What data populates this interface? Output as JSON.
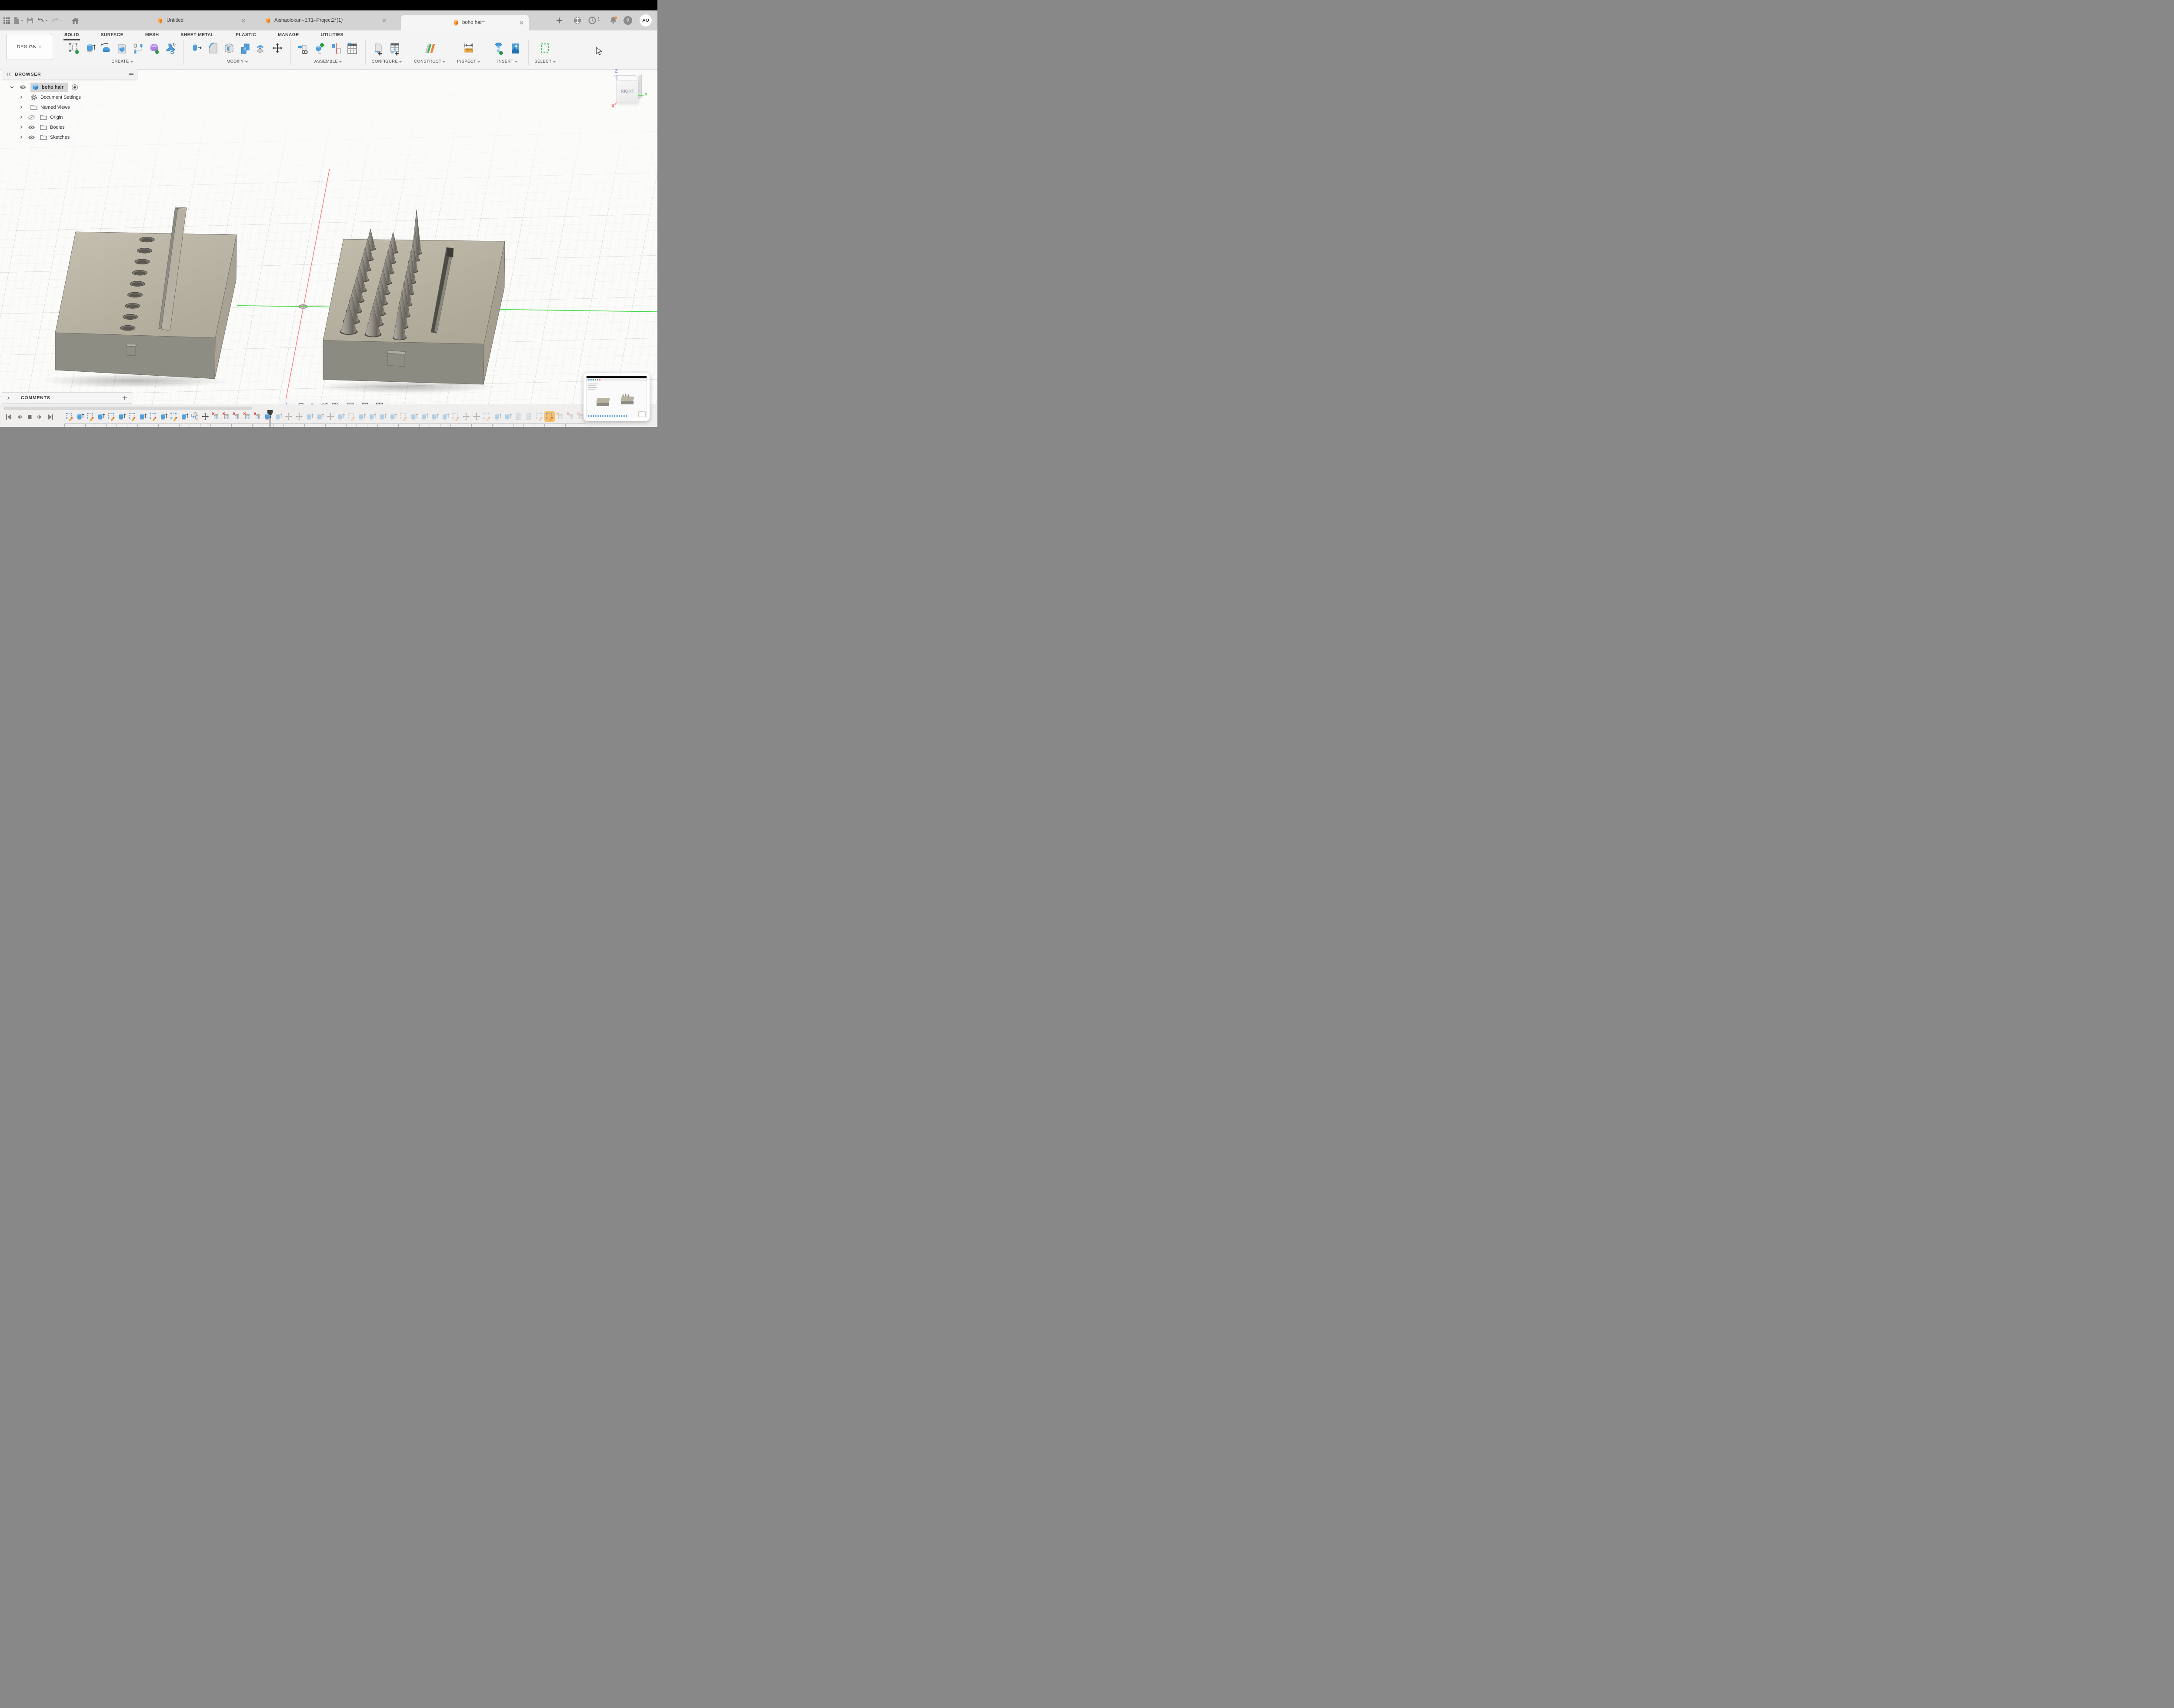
{
  "tabbar": {
    "tabs": [
      {
        "label": "Untitled"
      },
      {
        "label": "Aishaolokun–ET1–Project2*(1)"
      },
      {
        "label": "boho hair*"
      }
    ],
    "right": {
      "notification_count": "1",
      "help_glyph": "?",
      "avatar_initials": "AO"
    }
  },
  "ribbon": {
    "document_mode": "DESIGN",
    "tabs": [
      "SOLID",
      "SURFACE",
      "MESH",
      "SHEET METAL",
      "PLASTIC",
      "MANAGE",
      "UTILITIES"
    ],
    "active_tab": "SOLID",
    "groups": [
      {
        "label": "CREATE"
      },
      {
        "label": "MODIFY"
      },
      {
        "label": "ASSEMBLE"
      },
      {
        "label": "CONFIGURE"
      },
      {
        "label": "CONSTRUCT"
      },
      {
        "label": "INSPECT"
      },
      {
        "label": "INSERT"
      },
      {
        "label": "SELECT"
      }
    ]
  },
  "browser": {
    "title": "BROWSER",
    "root_label": "boho hair",
    "items": [
      "Document Settings",
      "Named Views",
      "Origin",
      "Bodies",
      "Sketches"
    ]
  },
  "viewcube": {
    "face_label": "RIGHT",
    "axis_x": "X",
    "axis_y": "Y",
    "axis_z": "Z"
  },
  "comments": {
    "label": "COMMENTS"
  },
  "timeline": {
    "playhead_index": 20,
    "features": [
      "sketch",
      "extrude",
      "sketch",
      "extrude",
      "sketch",
      "extrude",
      "sketch",
      "extrude",
      "sketch",
      "extrude",
      "sketch",
      "extrude",
      "copy",
      "move",
      "error",
      "error",
      "error",
      "error",
      "error",
      "extrude",
      "extrude",
      "move",
      "move",
      "extrude",
      "extrude",
      "move",
      "extrude",
      "sketch",
      "extrude",
      "extrude",
      "extrude",
      "extrude",
      "sketch",
      "extrude",
      "extrude",
      "extrude",
      "extrude",
      "sketch",
      "move",
      "move",
      "sketch",
      "extrude",
      "extrude",
      "mirror",
      "mirror",
      "sketch",
      "sketch_highlight",
      "error",
      "error",
      "error"
    ]
  },
  "colors": {
    "accent_orange": "#f18f3b",
    "active_tab_bg": "#f5f5f5",
    "block_top": "#bfbaab",
    "block_front": "#8e8d84",
    "block_side": "#a8a295",
    "axis_red": "#f57f7f",
    "axis_green": "#43d943",
    "select_green": "#2fb44c",
    "error_red": "#d6403b",
    "feature_blue": "#4d9fe0"
  }
}
